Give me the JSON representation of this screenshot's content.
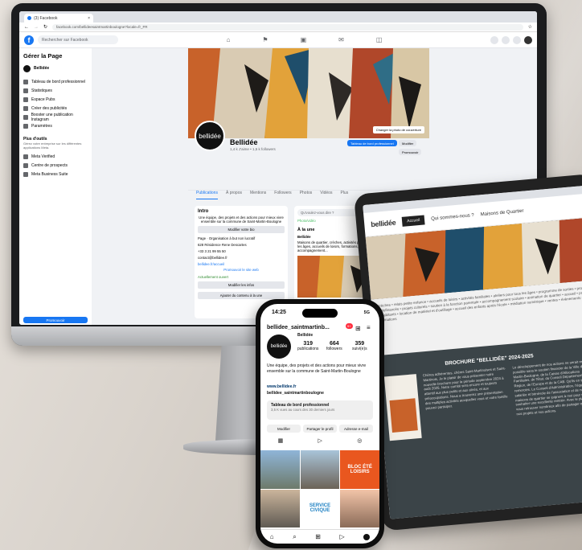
{
  "desktop": {
    "browser_tab": "(3) Facebook",
    "url": "facebook.com/bellideesaintmartinboulogne?locale=fr_FR",
    "search_placeholder": "Rechercher sur Facebook",
    "sidebar": {
      "title": "Gérer la Page",
      "page_name": "Bellidée",
      "items": [
        "Tableau de bord professionnel",
        "Statistiques",
        "Espace Pubs",
        "Créer des publicités",
        "Booster une publication Instagram",
        "Paramètres"
      ],
      "more_tools": "Plus d'outils",
      "more_tools_sub": "Gérez votre entreprise sur les différentes applications Meta.",
      "tools": [
        "Meta Verified",
        "Centre de prospects",
        "Meta Business Suite"
      ],
      "promote": "Promouvoir"
    },
    "profile": {
      "name": "Bellidée",
      "stats": "1,4 k J'aime • 1,5 k followers",
      "dashboard_button": "Tableau de bord professionnel",
      "edit_button": "Modifier",
      "promote_button": "Promouvoir",
      "cover_button": "Changer la photo de couverture",
      "avatar_text": "bellidée",
      "tabs": [
        "Publications",
        "À propos",
        "Mentions",
        "Followers",
        "Photos",
        "Vidéos",
        "Plus"
      ]
    },
    "intro": {
      "title": "Intro",
      "bio": "Une équipe, des projets et des actions pour mieux vivre ensemble sur la commune de Saint-Martin-Boulogne",
      "edit_bio": "Modifier votre bio",
      "details": [
        "Page · Organisation à but non lucratif",
        "628 Résidence Rene Descartes",
        "+33 3 21 99 55 50",
        "contact@bellidee.fr",
        "bellidee.fr/accueil"
      ],
      "promote_site": "Promouvoir le site web",
      "open_now": "Actuellement ouvert",
      "edit_infos": "Modifier les infos",
      "add_featured": "Ajouter du contenu à la une"
    },
    "feed": {
      "composer": "Qu'voulez-vous dire ?",
      "photo_video": "Photo/vidéo",
      "featured": "À la une",
      "post_author": "Bellidée",
      "post_text": "Maisons de quartier, crèches, activités pour tous les âges, accueils de loisirs, formations, accompagnement..."
    }
  },
  "tablet": {
    "logo": "bellidée",
    "nav": [
      "Accueil",
      "Qui sommes-nous ?",
      "Maisons de Quartier"
    ],
    "activities": "crèches • relais petite enfance • accueils de loisirs • activités familiales • ateliers pour tous les âges • programme de sorties • projets autofinancés • projets culturels • soutien à la fonction parentale • accompagnement scolaire • animation de quartier • accueil • projets d'habitants • location de matériel et d'outillage • accueil des enfants après l'école • médiation numérique • ventes • évènements • animations",
    "brochure_title": "BROCHURE \"BELLIDÉE\" 2024-2025",
    "brochure_left": "Chères adhérentes, chères Saint-Martinoises et Saint-Martinois, Je le plaisir de vous présenter notre nouvelle brochure pour la période septembre 2024 à août 2025. Notre comité sera encore et toujours attentif aux plus petits et aux aînés, et aux préoccupations. Nous a trouverez une présentation des multiples activités auxquelles vous et votre famille pouvez participer.",
    "brochure_right": "Le développement de nos actions ne serait rendu possible sans le soutien financier de la Ville de Saint-Martin-Boulogne, de la Caisse d'Allocations Familiales, de l'État, du Conseil Départemental, de la Région, de l'Europe et de la CAB. Qu'ils en soient ici remerciés. Le Conseil d'Administration, l'équipe salariée et bénévole de l'association et de nos maisons de quartier se joignent à moi pour vous souhaiter une excellente rentrée. Avec le plaisir de vous retrouver nombreux afin de partager ensemble nos projets et nos actions."
  },
  "phone": {
    "time": "14:25",
    "network": "5G",
    "username": "bellidee_saintmartinb...",
    "notif_count": "9+",
    "name": "Bellidée",
    "publications": "319",
    "publications_label": "publications",
    "followers": "664",
    "followers_label": "followers",
    "following": "359",
    "following_label": "suivi(e)s",
    "bio": "Une équipe, des projets et des actions pour mieux vivre ensemble sur la commune de Saint-Martin-Boulogne",
    "bio_more": "Saint-Martin-Boulogne",
    "link": "www.bellidee.fr",
    "threads": "bellidee_saintmartinboulogne",
    "dashboard_title": "Tableau de bord professionnel",
    "dashboard_sub": "3,5 K vues au cours des 30 derniers jours",
    "edit": "Modifier",
    "share": "Partager le profil",
    "email": "Adresse e-mail",
    "grid_text_1": "SERVICE",
    "grid_text_2": "CIVIQUE",
    "grid_poster": "BLOC ÉTÉ LOISIRS"
  },
  "colors": {
    "facebook_blue": "#1877f2",
    "dark_panel": "#3b4448",
    "device_black": "#1b1c1e",
    "ig_notif": "#ff3040"
  }
}
